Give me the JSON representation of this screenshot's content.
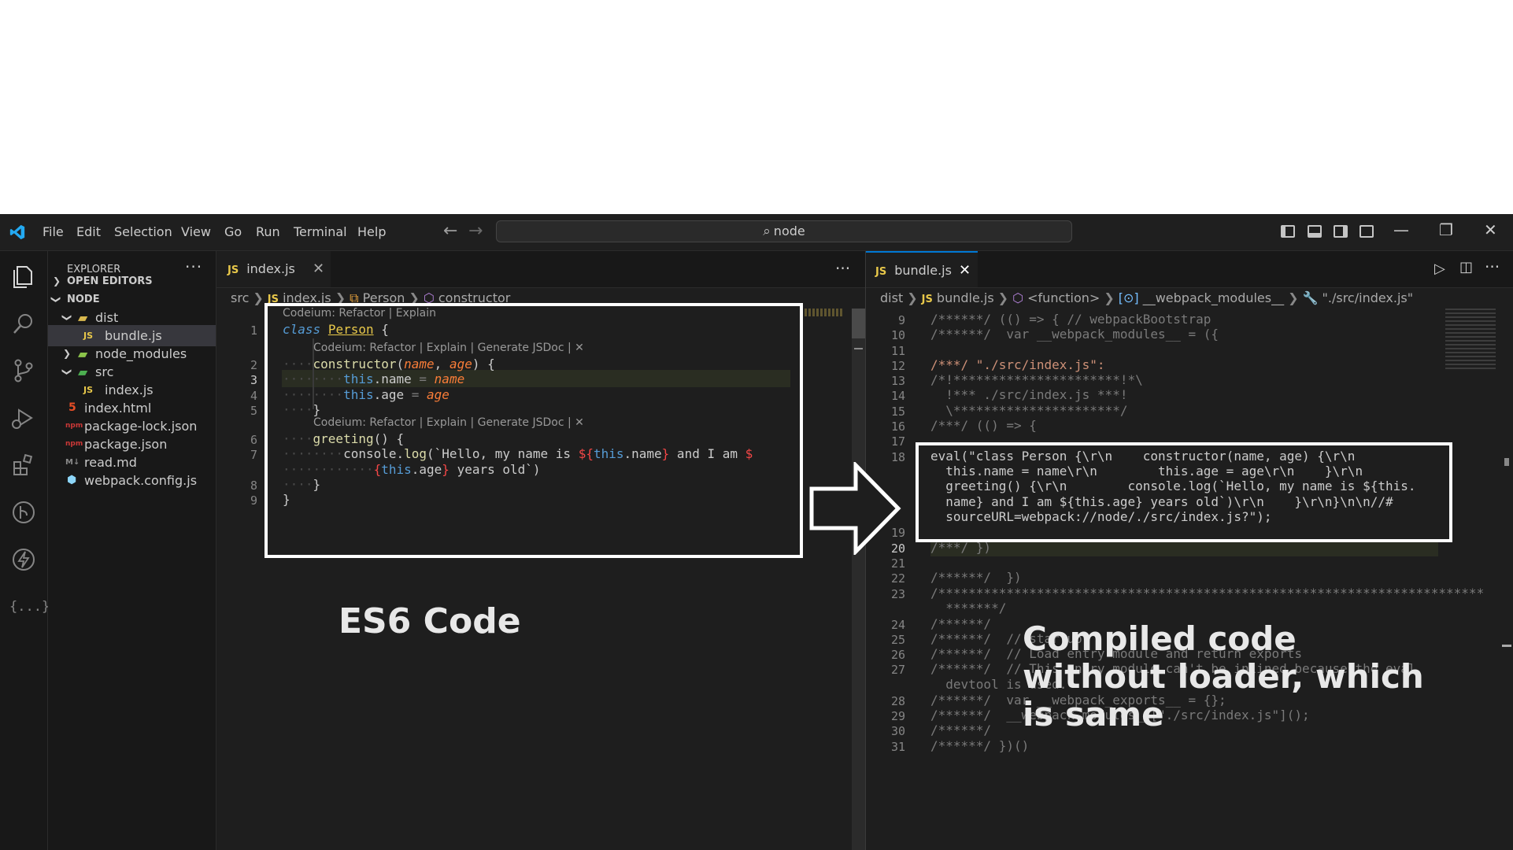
{
  "menu": [
    "File",
    "Edit",
    "Selection",
    "View",
    "Go",
    "Run",
    "Terminal",
    "Help"
  ],
  "command_center": {
    "text": "node",
    "icon": "search-icon"
  },
  "sidebar": {
    "title": "EXPLORER",
    "sections": {
      "open_editors": "OPEN EDITORS",
      "workspace": "NODE"
    },
    "items": [
      {
        "label": "dist",
        "icon": "folder-icon",
        "expanded": true
      },
      {
        "label": "bundle.js",
        "icon": "js-file-icon",
        "selected": true
      },
      {
        "label": "node_modules",
        "icon": "folder-icon",
        "expanded": false
      },
      {
        "label": "src",
        "icon": "folder-icon",
        "expanded": true
      },
      {
        "label": "index.js",
        "icon": "js-file-icon"
      },
      {
        "label": "index.html",
        "icon": "html-file-icon"
      },
      {
        "label": "package-lock.json",
        "icon": "npm-file-icon"
      },
      {
        "label": "package.json",
        "icon": "npm-file-icon"
      },
      {
        "label": "read.md",
        "icon": "markdown-file-icon"
      },
      {
        "label": "webpack.config.js",
        "icon": "webpack-file-icon"
      }
    ]
  },
  "left_editor": {
    "tab": {
      "label": "index.js",
      "icon_text": "JS"
    },
    "breadcrumb": [
      "src",
      "index.js",
      "Person",
      "constructor"
    ],
    "breadcrumb_js": "JS",
    "lens": {
      "class": "Codeium: Refactor | Explain",
      "constructor": "Codeium: Refactor | Explain | Generate JSDoc | ✕",
      "greeting": "Codeium: Refactor | Explain | Generate JSDoc | ✕"
    },
    "line_numbers": [
      "1",
      "2",
      "3",
      "4",
      "5",
      "6",
      "7",
      "8",
      "9"
    ],
    "code": {
      "l1_kw": "class",
      "l1_cls": "Person",
      "l1_rest": " {",
      "l2_fn": "constructor",
      "l2_p1": "name",
      "l2_p2": "age",
      "l2_rest": ") {",
      "l3_this": "this",
      "l3_prop": ".name",
      "l3_eq": " = ",
      "l3_val": "name",
      "l4_this": "this",
      "l4_prop": ".age",
      "l4_eq": " = ",
      "l4_val": "age",
      "l5": "}",
      "l6_fn": "greeting",
      "l6_rest": "() {",
      "l7_a": "console.",
      "l7_fn": "log",
      "l7_b": "(`Hello, my name is ",
      "l7_c": "${",
      "l7_d": "this",
      "l7_e": ".name",
      "l7_f": "}",
      "l7_g": " and I am ",
      "l7_h": "$",
      "l7w_a": "{",
      "l7w_b": "this",
      "l7w_c": ".age",
      "l7w_d": "}",
      "l7w_e": " years old`)",
      "l8": "}",
      "l9": "}"
    }
  },
  "right_editor": {
    "tab": {
      "label": "bundle.js",
      "icon_text": "JS"
    },
    "breadcrumb": [
      "dist",
      "bundle.js",
      "<function>",
      "__webpack_modules__",
      "\"./src/index.js\""
    ],
    "breadcrumb_js": "JS",
    "line_numbers": [
      "9",
      "10",
      "11",
      "12",
      "13",
      "14",
      "15",
      "16",
      "17",
      "18",
      "",
      "",
      "",
      "",
      "19",
      "20",
      "21",
      "22",
      "23",
      "",
      "24",
      "25",
      "26",
      "27",
      "",
      "28",
      "29",
      "30",
      "31"
    ],
    "lines": {
      "l9": "/******/ (() => { // webpackBootstrap",
      "l10": "/******/  var __webpack_modules__ = ({",
      "l12": "/***/ \"./src/index.js\":",
      "l13": "/*!**********************!*\\",
      "l14": "  !*** ./src/index.js ***!",
      "l15": "  \\**********************/",
      "l16": "/***/ (() => {",
      "l18a": "eval(\"class Person {\\r\\n    constructor(name, age) {\\r\\n        ",
      "l18b": "  this.name = name\\r\\n        this.age = age\\r\\n    }\\r\\n    ",
      "l18c": "  greeting() {\\r\\n        console.log(`Hello, my name is ${this.",
      "l18d": "  name} and I am ${this.age} years old`)\\r\\n    }\\r\\n}\\n\\n//#",
      "l18e": "  sourceURL=webpack://node/./src/index.js?\");",
      "l20": "/***/ })",
      "l22": "/******/  })",
      "l23a": "/************************************************************************",
      "l23b": "  *******/",
      "l24": "/******/ ",
      "l25": "/******/  // startup",
      "l26": "/******/  // Load entry module and return exports",
      "l27a": "/******/  // This entry module can't be inlined because the eval",
      "l27b": "  devtool is used.",
      "l28": "/******/  var __webpack_exports__ = {};",
      "l29": "/******/  __webpack_modules__[\"./src/index.js\"]();",
      "l30": "/******/ ",
      "l31": "/******/ })()"
    }
  },
  "annotations": {
    "left": "ES6 Code",
    "right_1": "Compiled code",
    "right_2": "without loader, which",
    "right_3": "is same"
  }
}
